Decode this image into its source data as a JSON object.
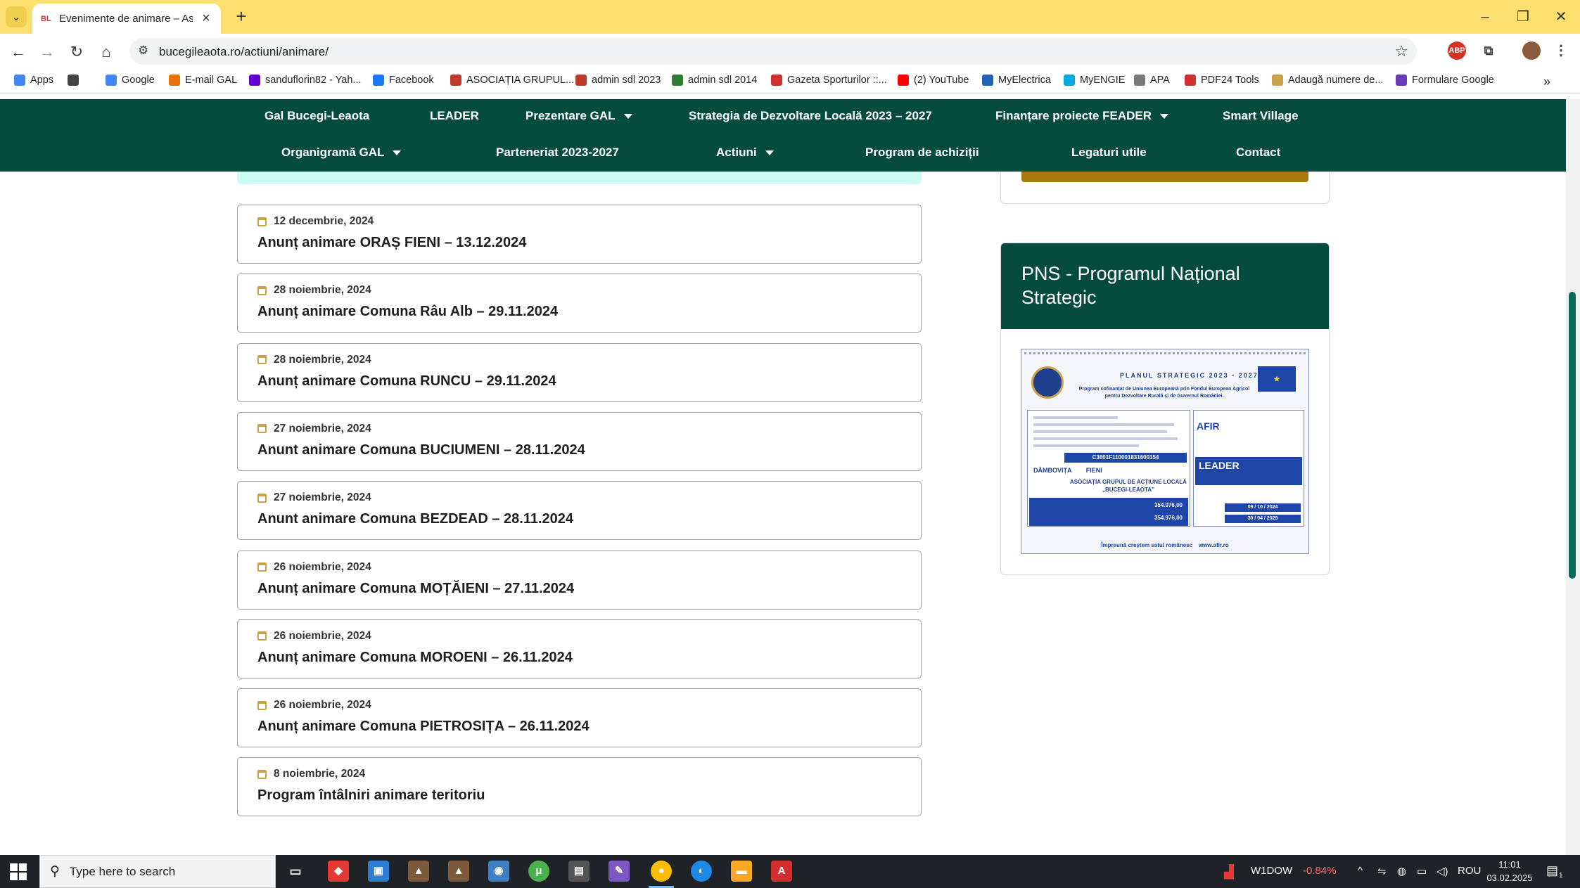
{
  "browser": {
    "tab_title": "Evenimente de animare – Asoci",
    "tab_favicon": "BL",
    "url": "bucegileaota.ro/actiuni/animare/",
    "new_tab_symbol": "+",
    "close_symbol": "×",
    "window_controls": [
      "–",
      "❐",
      "✕"
    ],
    "nav_icons": [
      "←",
      "→",
      "↻",
      "⌂"
    ],
    "extension_label": "ABP"
  },
  "bookmarks": [
    {
      "label": "Apps",
      "icon": "apps-grid-icon",
      "color": "#4285f4"
    },
    {
      "label": "",
      "icon": "tab-group-icon",
      "color": "#444444"
    },
    {
      "label": "Google",
      "icon": "google-icon",
      "color": "#4285f4"
    },
    {
      "label": "E-mail GAL",
      "icon": "email-icon",
      "color": "#e8710a"
    },
    {
      "label": "sanduflorin82 - Yah...",
      "icon": "yahoo-mail-icon",
      "color": "#6001d2"
    },
    {
      "label": "Facebook",
      "icon": "facebook-icon",
      "color": "#1877f2"
    },
    {
      "label": "ASOCIAȚIA GRUPUL...",
      "icon": "site-icon",
      "color": "#c03a2b"
    },
    {
      "label": "admin sdl 2023",
      "icon": "site-icon",
      "color": "#c03a2b"
    },
    {
      "label": "admin sdl 2014",
      "icon": "site-icon",
      "color": "#2e7d32"
    },
    {
      "label": "Gazeta Sporturilor ::...",
      "icon": "gazeta-icon",
      "color": "#d32f2f"
    },
    {
      "label": "(2) YouTube",
      "icon": "youtube-icon",
      "color": "#ff0000"
    },
    {
      "label": "MyElectrica",
      "icon": "electrica-icon",
      "color": "#1e63b5"
    },
    {
      "label": "MyENGIE",
      "icon": "engie-icon",
      "color": "#00a9e0"
    },
    {
      "label": "APA",
      "icon": "apa-icon",
      "color": "#7a7a7a"
    },
    {
      "label": "PDF24 Tools",
      "icon": "pdf24-icon",
      "color": "#d32f2f"
    },
    {
      "label": "Adaugă numere de...",
      "icon": "site-icon",
      "color": "#c9a24a"
    },
    {
      "label": "Formulare Google",
      "icon": "forms-icon",
      "color": "#673ab7"
    }
  ],
  "bookmarks_overflow": "»",
  "site_nav": {
    "row1": [
      {
        "label": "Gal Bucegi-Leaota",
        "dropdown": false
      },
      {
        "label": "LEADER",
        "dropdown": false
      },
      {
        "label": "Prezentare GAL",
        "dropdown": true
      },
      {
        "label": "Strategia de Dezvoltare Locală 2023 – 2027",
        "dropdown": false
      },
      {
        "label": "Finanțare proiecte FEADER",
        "dropdown": true
      },
      {
        "label": "Smart Village",
        "dropdown": false
      }
    ],
    "row2": [
      {
        "label": "Organigramă GAL",
        "dropdown": true
      },
      {
        "label": "Parteneriat 2023-2027",
        "dropdown": false
      },
      {
        "label": "Actiuni",
        "dropdown": true
      },
      {
        "label": "Program de achiziții",
        "dropdown": false
      },
      {
        "label": "Legaturi utile",
        "dropdown": false
      },
      {
        "label": "Contact",
        "dropdown": false
      }
    ]
  },
  "posts": [
    {
      "date": "12 decembrie, 2024",
      "title": "Anunț animare ORAȘ FIENI – 13.12.2024"
    },
    {
      "date": "28 noiembrie, 2024",
      "title": "Anunț animare Comuna Râu Alb – 29.11.2024"
    },
    {
      "date": "28 noiembrie, 2024",
      "title": "Anunț animare Comuna RUNCU – 29.11.2024"
    },
    {
      "date": "27 noiembrie, 2024",
      "title": "Anunt animare Comuna BUCIUMENI – 28.11.2024"
    },
    {
      "date": "27 noiembrie, 2024",
      "title": "Anunt animare Comuna BEZDEAD – 28.11.2024"
    },
    {
      "date": "26 noiembrie, 2024",
      "title": "Anunț animare Comuna MOȚĂIENI – 27.11.2024"
    },
    {
      "date": "26 noiembrie, 2024",
      "title": "Anunț animare Comuna MOROENI – 26.11.2024"
    },
    {
      "date": "26 noiembrie, 2024",
      "title": "Anunț animare Comuna PIETROSIȚA – 26.11.2024"
    },
    {
      "date": "8 noiembrie, 2024",
      "title": "Program întâlniri animare teritoriu"
    }
  ],
  "sidebar": {
    "pns_title": "PNS - Programul Național Strategic",
    "poster": {
      "title": "PLANUL STRATEGIC 2023 - 2027",
      "subtitle": "Program cofinanțat de Uniunea Europeană prin Fondul European Agricol pentru Dezvoltare Rurală și de Guvernul României.",
      "code": "C3601F110001831600154",
      "county": "DÂMBOVIȚA",
      "locality": "FIENI",
      "beneficiary": "ASOCIAȚIA GRUPUL DE ACȚIUNE LOCALĂ „BUCEGI-LEAOTA”",
      "value_total": "354.976,00",
      "value_grant": "354.976,00",
      "authority": "AFIR",
      "program": "LEADER",
      "start_date": "09 / 10 / 2024",
      "end_date": "30 / 04 / 2029",
      "footer": "Împreună creștem satul românesc",
      "website": "www.afir.ro"
    }
  },
  "taskbar": {
    "search_placeholder": "Type here to search",
    "stock_label": "W1DOW",
    "stock_change": "-0.84%",
    "language": "ROU",
    "time": "11:01",
    "date": "03.02.2025",
    "notification_count": "1"
  },
  "colors": {
    "nav_green": "#054c3f",
    "chrome_yellow": "#fbe06f",
    "gold": "#aa7a12",
    "stock_red": "#ff6b6b"
  }
}
